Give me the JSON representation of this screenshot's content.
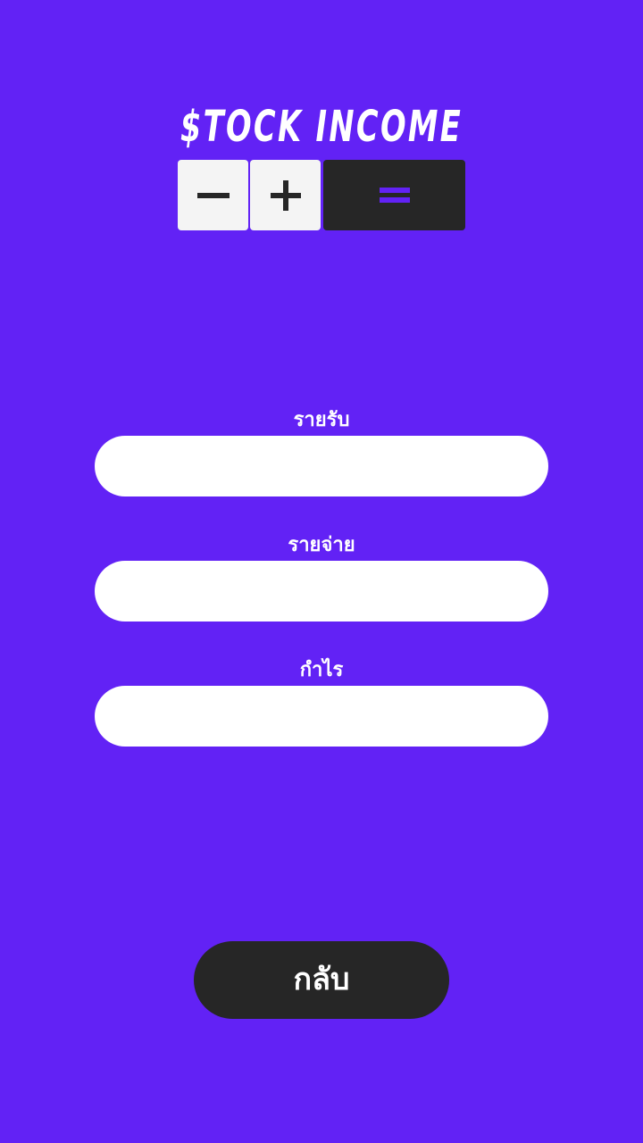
{
  "header": {
    "title": "$TOCK INCOME",
    "icons": [
      "minus-icon",
      "plus-icon",
      "equals-icon"
    ],
    "tile_colors": {
      "light": "#f4f4f4",
      "dark": "#262626",
      "accent": "#6222f5"
    }
  },
  "form": {
    "income_label": "รายรับ",
    "income_value": "",
    "expense_label": "รายจ่าย",
    "expense_value": "",
    "profit_label": "กำไร",
    "profit_value": ""
  },
  "footer": {
    "back_label": "กลับ"
  },
  "colors": {
    "background": "#6222f5",
    "field": "#ffffff",
    "button": "#262626",
    "text": "#ffffff"
  }
}
